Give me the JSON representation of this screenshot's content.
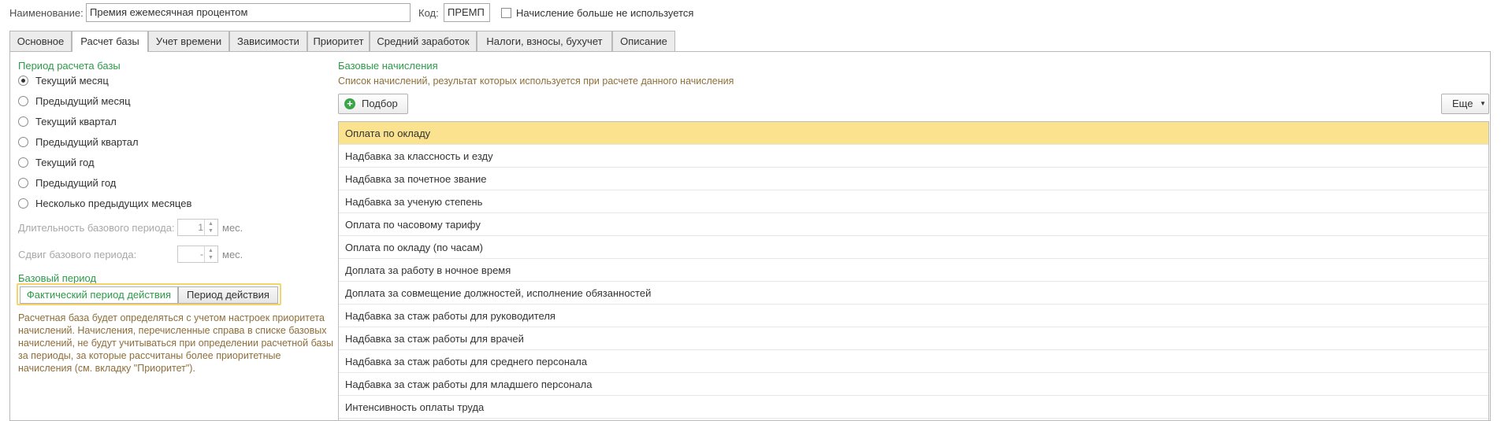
{
  "header": {
    "name_label": "Наименование:",
    "name_value": "Премия ежемесячная процентом",
    "code_label": "Код:",
    "code_value": "ПРЕМП",
    "unused_label": "Начисление больше не используется"
  },
  "tabs": [
    {
      "label": "Основное"
    },
    {
      "label": "Расчет базы"
    },
    {
      "label": "Учет времени"
    },
    {
      "label": "Зависимости"
    },
    {
      "label": "Приоритет"
    },
    {
      "label": "Средний заработок"
    },
    {
      "label": "Налоги, взносы, бухучет"
    },
    {
      "label": "Описание"
    }
  ],
  "period": {
    "title": "Период расчета базы",
    "selected": "Текущий месяц",
    "options": [
      "Текущий месяц",
      "Предыдущий месяц",
      "Текущий квартал",
      "Предыдущий квартал",
      "Текущий год",
      "Предыдущий год",
      "Несколько предыдущих месяцев"
    ],
    "duration_label": "Длительность базового периода:",
    "duration_value": "1",
    "duration_unit": "мес.",
    "shift_label": "Сдвиг базового периода:",
    "shift_value": "-",
    "shift_unit": "мес."
  },
  "base_period": {
    "title": "Базовый период",
    "options": [
      "Фактический период действия",
      "Период действия"
    ],
    "selected": "Фактический период действия",
    "description": "Расчетная база будет определяться с учетом настроек приоритета начислений. Начисления, перечисленные справа в списке базовых начислений, не будут учитываться при определении расчетной базы за периоды, за которые рассчитаны более приоритетные начисления (см. вкладку \"Приоритет\")."
  },
  "base_accruals": {
    "title": "Базовые начисления",
    "subtitle": "Список начислений, результат которых используется при расчете данного начисления",
    "pick_button": "Подбор",
    "more_button": "Еще",
    "items": [
      "Оплата по окладу",
      "Надбавка за классность и езду",
      "Надбавка за почетное звание",
      "Надбавка за ученую степень",
      "Оплата по часовому тарифу",
      "Оплата по окладу (по часам)",
      "Доплата за работу в ночное время",
      "Доплата за совмещение должностей, исполнение обязанностей",
      "Надбавка за стаж работы для руководителя",
      "Надбавка за стаж работы для врачей",
      "Надбавка за стаж работы для среднего персонала",
      "Надбавка за стаж работы для младшего персонала",
      "Интенсивность оплаты труда"
    ]
  },
  "colors": {
    "accent_green": "#2c9a48",
    "selected_row": "#fbe28e",
    "segment_border": "#f5d46a",
    "description_text": "#8e6f3a"
  }
}
